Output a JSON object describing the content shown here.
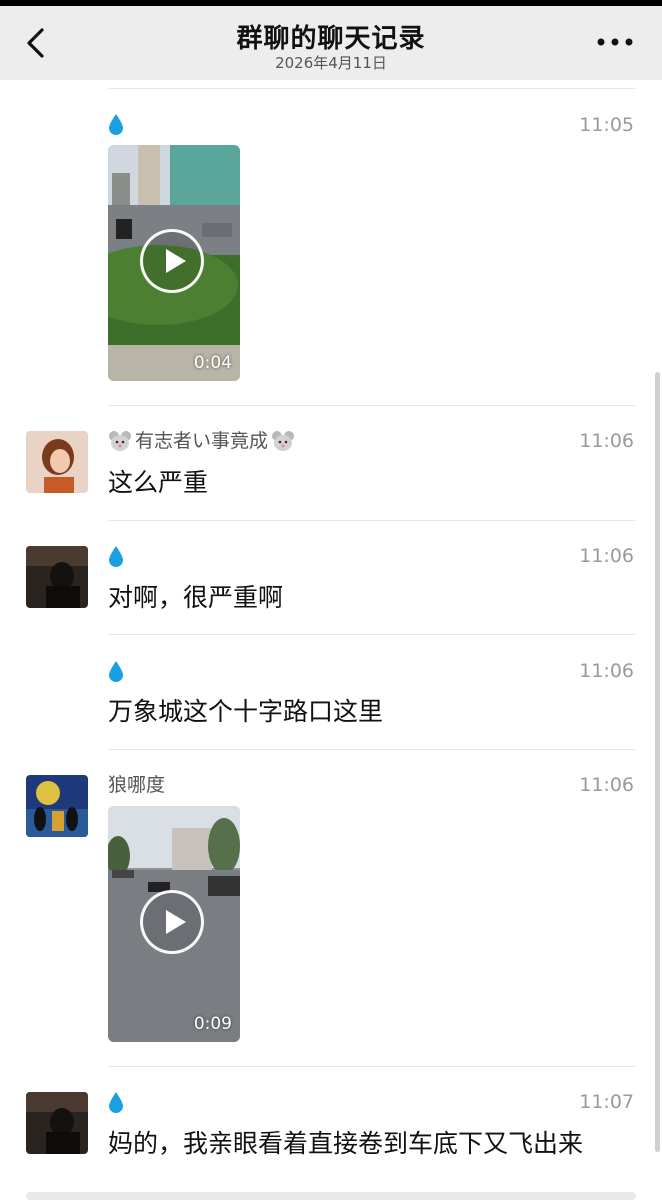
{
  "header": {
    "title": "群聊的聊天记录",
    "date": "2026年4月11日"
  },
  "messages": [
    {
      "sender": "",
      "time": "11:05",
      "video_duration": "0:04"
    },
    {
      "sender": "有志者い事竟成",
      "time": "11:06",
      "text": "这么严重"
    },
    {
      "sender": "",
      "time": "11:06",
      "text": "对啊，很严重啊"
    },
    {
      "sender": "",
      "time": "11:06",
      "text": "万象城这个十字路口这里"
    },
    {
      "sender": "狼哪度",
      "time": "11:06",
      "video_duration": "0:09"
    },
    {
      "sender": "",
      "time": "11:07",
      "text": "妈的，我亲眼看着直接卷到车底下又飞出来"
    }
  ],
  "icons": {
    "back": "back-arrow-icon",
    "more": "more-dots-icon",
    "drop": "water-drop-icon",
    "mouse": "mouse-emoji-icon",
    "play": "play-icon"
  },
  "colors": {
    "header_bg": "#ededed",
    "drop": "#1aa0e0"
  }
}
